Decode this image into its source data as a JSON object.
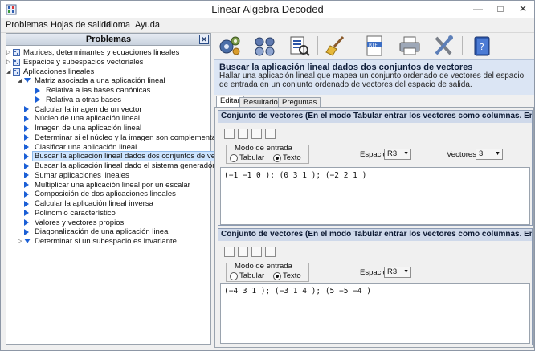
{
  "window": {
    "title": "Linear Algebra Decoded"
  },
  "menu": [
    "Problemas",
    "Hojas de salida",
    "Idioma",
    "Ayuda"
  ],
  "sidebar": {
    "title": "Problemas",
    "items": [
      {
        "label": "Matrices, determinantes y ecuaciones lineales",
        "level": 0,
        "toggle": "collapsed",
        "icon": "folder-icon"
      },
      {
        "label": "Espacios y subespacios vectoriales",
        "level": 0,
        "toggle": "collapsed",
        "icon": "folder-icon"
      },
      {
        "label": "Aplicaciones lineales",
        "level": 0,
        "toggle": "expanded",
        "icon": "folder-icon"
      },
      {
        "label": "Matriz asociada a una aplicación lineal",
        "level": 1,
        "toggle": "expanded",
        "icon": "expanded-triangle-icon"
      },
      {
        "label": "Relativa a las bases canónicas",
        "level": 2,
        "toggle": "",
        "icon": "triangle-icon"
      },
      {
        "label": "Relativa a otras bases",
        "level": 2,
        "toggle": "",
        "icon": "triangle-icon"
      },
      {
        "label": "Calcular la imagen de un vector",
        "level": 1,
        "toggle": "",
        "icon": "triangle-icon"
      },
      {
        "label": "Núcleo de una aplicación lineal",
        "level": 1,
        "toggle": "",
        "icon": "triangle-icon"
      },
      {
        "label": "Imagen de una aplicación lineal",
        "level": 1,
        "toggle": "",
        "icon": "triangle-icon"
      },
      {
        "label": "Determinar si el núcleo y la imagen son complementarios",
        "level": 1,
        "toggle": "",
        "icon": "triangle-icon"
      },
      {
        "label": "Clasificar una aplicación lineal",
        "level": 1,
        "toggle": "",
        "icon": "triangle-icon"
      },
      {
        "label": "Buscar la aplicación lineal dados dos conjuntos de vectores",
        "level": 1,
        "toggle": "",
        "icon": "triangle-icon",
        "selected": true
      },
      {
        "label": "Buscar la aplicación lineal dado el sistema generador de la im",
        "level": 1,
        "toggle": "",
        "icon": "triangle-icon"
      },
      {
        "label": "Sumar aplicaciones lineales",
        "level": 1,
        "toggle": "",
        "icon": "triangle-icon"
      },
      {
        "label": "Multiplicar una aplicación lineal por un escalar",
        "level": 1,
        "toggle": "",
        "icon": "triangle-icon"
      },
      {
        "label": "Composición de dos aplicaciones lineales",
        "level": 1,
        "toggle": "",
        "icon": "triangle-icon"
      },
      {
        "label": "Calcular la aplicación lineal inversa",
        "level": 1,
        "toggle": "",
        "icon": "triangle-icon"
      },
      {
        "label": "Polinomio característico",
        "level": 1,
        "toggle": "",
        "icon": "triangle-icon"
      },
      {
        "label": "Valores y vectores propios",
        "level": 1,
        "toggle": "",
        "icon": "triangle-icon"
      },
      {
        "label": "Diagonalización de una aplicación lineal",
        "level": 1,
        "toggle": "",
        "icon": "triangle-icon"
      },
      {
        "label": "Determinar si un subespacio es invariante",
        "level": 1,
        "toggle": "collapsed",
        "icon": "expanded-triangle-icon"
      }
    ]
  },
  "toolbar": {
    "buttons": [
      "solve-gears-icon",
      "vectors-icon",
      "checklist-icon",
      "broom-icon",
      "rtf-export-icon",
      "print-icon",
      "tools-icon",
      "help-book-icon"
    ]
  },
  "problem": {
    "title": "Buscar la aplicación lineal dados dos conjuntos de vectores",
    "description": "Hallar una aplicación lineal que mapea un conjunto ordenado de vectores del espacio de entrada en un conjunto ordenado de vectores del espacio de salida."
  },
  "tabs": [
    "Editar",
    "Resultados",
    "Preguntas"
  ],
  "panel1": {
    "header": "Conjunto de vectores (En el modo Tabular entrar los vectores como columnas. En el m",
    "mode_label": "Modo de entrada",
    "radio_tabular": "Tabular",
    "radio_texto": "Texto",
    "selected_mode": "Texto",
    "space_label": "Espacio",
    "space_value": "R3",
    "vectors_label": "Vectores",
    "vectors_value": "3",
    "text": "(−1 −1 0 ); (0 3 1 ); (−2 2 1 )"
  },
  "panel2": {
    "header": "Conjunto de vectores (En el modo Tabular entrar los vectores como columnas. En el m",
    "mode_label": "Modo de entrada",
    "radio_tabular": "Tabular",
    "radio_texto": "Texto",
    "selected_mode": "Texto",
    "space_label": "Espacio",
    "space_value": "R3",
    "text": "(−4 3 1 ); (−3 1 4 ); (5 −5 −4 )"
  }
}
